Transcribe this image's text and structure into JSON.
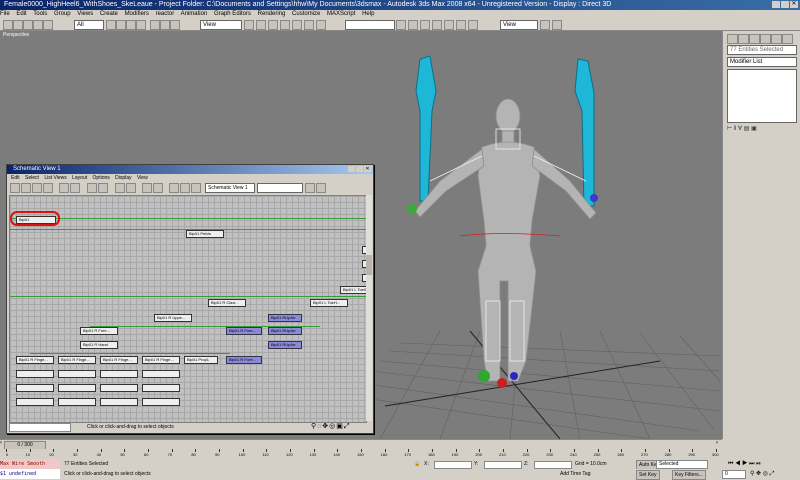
{
  "app": {
    "title": "Female0000_HighHeel6_WithShoes_SkeLeaue - Project Folder: C:\\Documents and Settings\\hhw\\My Documents\\3dsmax - Autodesk 3ds Max 2008 x64 - Unregistered Version - Display : Direct 3D"
  },
  "menubar": [
    "File",
    "Edit",
    "Tools",
    "Group",
    "Views",
    "Create",
    "Modifiers",
    "reactor",
    "Animation",
    "Graph Editors",
    "Rendering",
    "Customize",
    "MAXScript",
    "Help"
  ],
  "toolbar": {
    "selection_filter": "All",
    "ref_coord": "View",
    "ref_coord2": "View",
    "named_sel": ""
  },
  "viewport": {
    "label": "Perspective"
  },
  "cmdpanel": {
    "selection_count": "77 Entities Selected",
    "modifier_list": "Modifier List"
  },
  "schematic": {
    "title": "Schematic View 1",
    "menu": [
      "Edit",
      "Select",
      "List Views",
      "Layout",
      "Options",
      "Display",
      "View"
    ],
    "view_name": "Schematic View 1",
    "status": "Click or click-and-drag to select objects",
    "nodes": [
      {
        "label": "Bip01",
        "sel": false
      },
      {
        "label": "Bip01 Pelvis",
        "sel": false
      },
      {
        "label": "Bip01 R Clavi...",
        "sel": false
      },
      {
        "label": "Bip01 L Toe0",
        "sel": false
      },
      {
        "label": "Bip01 L ToeH...",
        "sel": false
      },
      {
        "label": "Bip01 R Uppe...",
        "sel": false
      },
      {
        "label": "Bip01 R Fore...",
        "sel": false
      },
      {
        "label": "Bip01 R Hand",
        "sel": false
      },
      {
        "label": "Bip01 R Finge...",
        "sel": false
      },
      {
        "label": "Bip01 R Finge...",
        "sel": false
      },
      {
        "label": "Bip01 R Finge...",
        "sel": false
      },
      {
        "label": "Bip01 R Finge...",
        "sel": false
      },
      {
        "label": "Bip01 Prop1",
        "sel": false
      },
      {
        "label": "Bip01 R Fore...",
        "sel": true
      },
      {
        "label": "Bip01 R Fore...",
        "sel": true
      },
      {
        "label": "Bip01 RUpArr",
        "sel": true
      },
      {
        "label": "Bip01 RUpArr",
        "sel": true
      },
      {
        "label": "Bip01 RUpArr",
        "sel": true
      }
    ]
  },
  "timeline": {
    "frame": "0 / 300",
    "ticks": [
      "0",
      "10",
      "20",
      "30",
      "40",
      "50",
      "60",
      "70",
      "80",
      "90",
      "100",
      "110",
      "120",
      "130",
      "140",
      "150",
      "160",
      "170",
      "180",
      "190",
      "200",
      "210",
      "220",
      "230",
      "240",
      "250",
      "260",
      "270",
      "280",
      "290",
      "300"
    ]
  },
  "status": {
    "maxscript_line1": "Max Wire Smooth",
    "maxscript_line2": "$1 undefined",
    "selection": "77 Entities Selected",
    "prompt": "Click or click-and-drag to select objects",
    "grid": "Grid = 10.0cm",
    "add_time_tag": "Add Time Tag",
    "auto_key": "Auto Key",
    "set_key": "Set Key",
    "selected": "Selected",
    "key_filters": "Key Filters...",
    "frame_field": "0",
    "x": "X:",
    "y": "Y:",
    "z": "Z:"
  },
  "colors": {
    "viewport_bg": "#7c7c7c",
    "biped_arm": "#1fb7d8",
    "highlight_ring": "#e01010",
    "selected_node": "#8a8ad8"
  }
}
